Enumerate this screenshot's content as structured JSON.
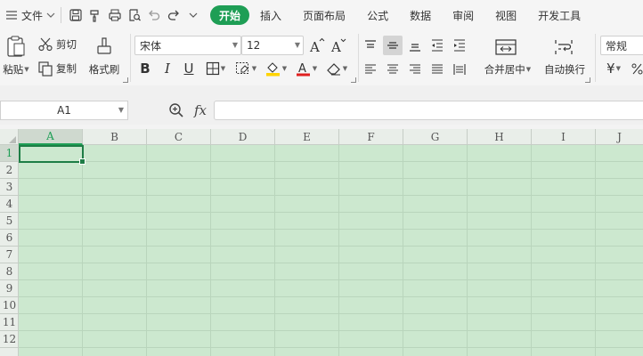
{
  "menu": {
    "file_label": "文件",
    "tabs": [
      {
        "label": "开始",
        "active": true
      },
      {
        "label": "插入",
        "active": false
      },
      {
        "label": "页面布局",
        "active": false
      },
      {
        "label": "公式",
        "active": false
      },
      {
        "label": "数据",
        "active": false
      },
      {
        "label": "审阅",
        "active": false
      },
      {
        "label": "视图",
        "active": false
      },
      {
        "label": "开发工具",
        "active": false
      }
    ],
    "quick_access_icons": [
      "save-icon",
      "format-painter-icon",
      "print-icon",
      "print-preview-icon",
      "undo-icon",
      "redo-icon",
      "customize-icon"
    ]
  },
  "ribbon": {
    "paste_label": "粘贴",
    "cut_label": "剪切",
    "copy_label": "复制",
    "format_painter_label": "格式刷",
    "font_name": "宋体",
    "font_size": "12",
    "bold": "B",
    "italic": "I",
    "underline": "U",
    "merge_center_label": "合并居中",
    "wrap_text_label": "自动换行",
    "number_format": "常规",
    "currency_symbol": "¥",
    "font_color": "#e02020",
    "fill_color": "#ffd400"
  },
  "formula_bar": {
    "cell_ref": "A1",
    "fx_label": "fx",
    "value": ""
  },
  "sheet": {
    "columns": [
      "A",
      "B",
      "C",
      "D",
      "E",
      "F",
      "G",
      "H",
      "I",
      "J"
    ],
    "rows": [
      "1",
      "2",
      "3",
      "4",
      "5",
      "6",
      "7",
      "8",
      "9",
      "10",
      "11",
      "12"
    ],
    "selected_cell": "A1",
    "background_color": "#cce8cf",
    "accent_color": "#1e9e55"
  }
}
